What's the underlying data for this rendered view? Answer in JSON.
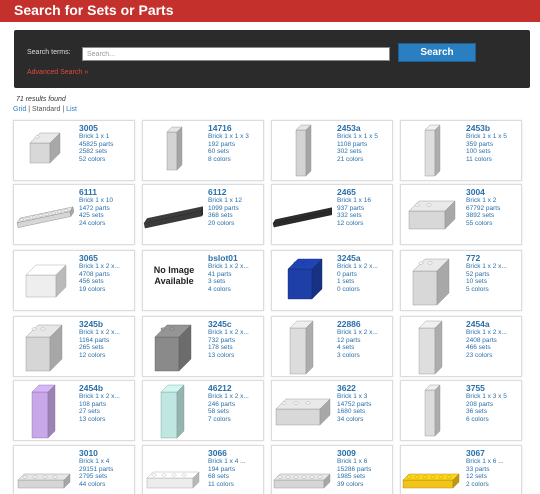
{
  "header": {
    "title": "Search for Sets or Parts"
  },
  "search": {
    "label": "Search terms:",
    "placeholder": "Search...",
    "button": "Search",
    "advanced": "Advanced Search »"
  },
  "results": {
    "count_text": "71 results found",
    "views": [
      "Grid",
      "Standard",
      "List"
    ]
  },
  "colors": {
    "header": "#c4302b",
    "link": "#2a6fa8",
    "button": "#2a7fc1"
  },
  "parts": [
    {
      "num": "3005",
      "desc": "Brick 1 x 1",
      "parts": "45825 parts",
      "sets": "2582 sets",
      "colors": "52 colors",
      "shape": "brick1x1",
      "color": "#d8d8d8"
    },
    {
      "num": "14716",
      "desc": "Brick 1 x 1 x 3",
      "parts": "192 parts",
      "sets": "60 sets",
      "colors": "8 colors",
      "shape": "tall3",
      "color": "#d4d4d4"
    },
    {
      "num": "2453a",
      "desc": "Brick 1 x 1 x 5",
      "parts": "1108 parts",
      "sets": "302 sets",
      "colors": "21 colors",
      "shape": "tall5",
      "color": "#d4d4d4"
    },
    {
      "num": "2453b",
      "desc": "Brick 1 x 1 x 5",
      "parts": "359 parts",
      "sets": "100 sets",
      "colors": "11 colors",
      "shape": "tall5",
      "color": "#dedede"
    },
    {
      "num": "6111",
      "desc": "Brick 1 x 10",
      "parts": "1472 parts",
      "sets": "425 sets",
      "colors": "24 colors",
      "shape": "long10",
      "color": "#d6d6d6"
    },
    {
      "num": "6112",
      "desc": "Brick 1 x 12",
      "parts": "1099 parts",
      "sets": "368 sets",
      "colors": "20 colors",
      "shape": "long12",
      "color": "#3a3a3a"
    },
    {
      "num": "2465",
      "desc": "Brick 1 x 16",
      "parts": "937 parts",
      "sets": "332 sets",
      "colors": "12 colors",
      "shape": "long16",
      "color": "#2a2a2a"
    },
    {
      "num": "3004",
      "desc": "Brick 1 x 2",
      "parts": "67792 parts",
      "sets": "3892 sets",
      "colors": "55 colors",
      "shape": "brick1x2",
      "color": "#d8d8d8"
    },
    {
      "num": "3065",
      "desc": "Brick 1 x 2 x...",
      "parts": "4708 parts",
      "sets": "456 sets",
      "colors": "19 colors",
      "shape": "clear",
      "color": "#eeeeee"
    },
    {
      "num": "bslot01",
      "desc": "Brick 1 x 2 x...",
      "parts": "41 parts",
      "sets": "3 sets",
      "colors": "4 colors",
      "shape": "noimage",
      "color": "",
      "noimage_text": "No Image Available"
    },
    {
      "num": "3245a",
      "desc": "Brick 1 x 2 x...",
      "parts": "0 parts",
      "sets": "1 sets",
      "colors": "0 colors",
      "shape": "blue",
      "color": "#1e3fa8"
    },
    {
      "num": "772",
      "desc": "Brick 1 x 2 x...",
      "parts": "52 parts",
      "sets": "10 sets",
      "colors": "5 colors",
      "shape": "brick1x2tall",
      "color": "#d8d8d8"
    },
    {
      "num": "3245b",
      "desc": "Brick 1 x 2 x...",
      "parts": "1164 parts",
      "sets": "265 sets",
      "colors": "12 colors",
      "shape": "brick1x2tall",
      "color": "#d6d6d6"
    },
    {
      "num": "3245c",
      "desc": "Brick 1 x 2 x...",
      "parts": "732 parts",
      "sets": "178 sets",
      "colors": "13 colors",
      "shape": "brick1x2tall",
      "color": "#8a8a8a"
    },
    {
      "num": "22886",
      "desc": "Brick 1 x 2 x...",
      "parts": "12 parts",
      "sets": "4 sets",
      "colors": "3 colors",
      "shape": "tall5wide",
      "color": "#dcdcdc"
    },
    {
      "num": "2454a",
      "desc": "Brick 1 x 2 x...",
      "parts": "2408 parts",
      "sets": "466 sets",
      "colors": "23 colors",
      "shape": "tall5wide",
      "color": "#dedede"
    },
    {
      "num": "2454b",
      "desc": "Brick 1 x 2 x...",
      "parts": "108 parts",
      "sets": "27 sets",
      "colors": "13 colors",
      "shape": "tall5wide",
      "color": "#c8a8e8"
    },
    {
      "num": "46212",
      "desc": "Brick 1 x 2 x...",
      "parts": "246 parts",
      "sets": "58 sets",
      "colors": "7 colors",
      "shape": "tall5wide",
      "color": "#bfe6e0"
    },
    {
      "num": "3622",
      "desc": "Brick 1 x 3",
      "parts": "14752 parts",
      "sets": "1680 sets",
      "colors": "34 colors",
      "shape": "brick1x3",
      "color": "#d8d8d8"
    },
    {
      "num": "3755",
      "desc": "Brick 1 x 3 x 5",
      "parts": "208 parts",
      "sets": "36 sets",
      "colors": "6 colors",
      "shape": "tall5",
      "color": "#dcdcdc"
    },
    {
      "num": "3010",
      "desc": "Brick 1 x 4",
      "parts": "29151 parts",
      "sets": "2795 sets",
      "colors": "44 colors",
      "shape": "long4",
      "color": "#d6d6d6"
    },
    {
      "num": "3066",
      "desc": "Brick 1 x 4 ...",
      "parts": "194 parts",
      "sets": "68 sets",
      "colors": "11 colors",
      "shape": "long4clear",
      "color": "#ececec"
    },
    {
      "num": "3009",
      "desc": "Brick 1 x 6",
      "parts": "15286 parts",
      "sets": "1985 sets",
      "colors": "39 colors",
      "shape": "long6",
      "color": "#d6d6d6"
    },
    {
      "num": "3067",
      "desc": "Brick 1 x 6 ...",
      "parts": "33 parts",
      "sets": "12 sets",
      "colors": "2 colors",
      "shape": "long6",
      "color": "#f2c418"
    }
  ]
}
